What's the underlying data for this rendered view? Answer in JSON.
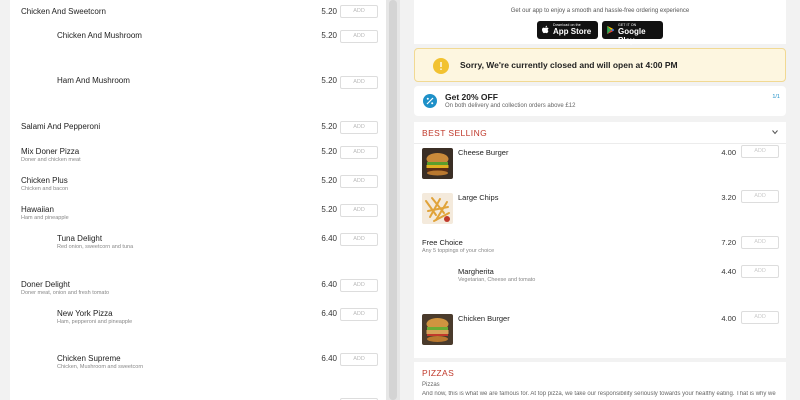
{
  "left_menu": {
    "add_label": "ADD",
    "items": [
      {
        "name": "Chicken And Sweetcorn",
        "desc": "",
        "price": "5.20"
      },
      {
        "name": "Chicken And Mushroom",
        "desc": "",
        "price": "5.20"
      },
      {
        "name": "Ham And Mushroom",
        "desc": "",
        "price": "5.20"
      },
      {
        "name": "Salami And Pepperoni",
        "desc": "",
        "price": "5.20"
      },
      {
        "name": "Mix Doner Pizza",
        "desc": "Doner and chicken meat",
        "price": "5.20"
      },
      {
        "name": "Chicken Plus",
        "desc": "Chicken and bacon",
        "price": "5.20"
      },
      {
        "name": "Hawaiian",
        "desc": "Ham and pineapple",
        "price": "5.20"
      },
      {
        "name": "Tuna Delight",
        "desc": "Red onion, sweetcorn and tuna",
        "price": "6.40"
      },
      {
        "name": "Doner Delight",
        "desc": "Doner meat, onion and fresh tomato",
        "price": "6.40"
      },
      {
        "name": "New York Pizza",
        "desc": "Ham, pepperoni and pineapple",
        "price": "6.40"
      },
      {
        "name": "Chicken Supreme",
        "desc": "Chicken, Mushroom and sweetcorn",
        "price": "6.40"
      }
    ]
  },
  "download": {
    "subtitle": "Get our app to enjoy a smooth and hassle-free ordering experience",
    "appstore_small": "Download on the",
    "appstore_large": "App Store",
    "googleplay_small": "GET IT ON",
    "googleplay_large": "Google Play"
  },
  "closed_notice": {
    "text": "Sorry, We're currently closed and will open at 4:00 PM"
  },
  "offer": {
    "title": "Get 20% OFF",
    "subtitle": "On both delivery and collection orders above £12",
    "pager": "1/1"
  },
  "best_selling": {
    "heading": "BEST SELLING",
    "add_label": "ADD",
    "items": [
      {
        "name": "Cheese Burger",
        "desc": "",
        "price": "4.00",
        "image": "burger"
      },
      {
        "name": "Large Chips",
        "desc": "",
        "price": "3.20",
        "image": "chips"
      },
      {
        "name": "Free Choice",
        "desc": "Any 5 toppings of your choice",
        "price": "7.20",
        "image": ""
      },
      {
        "name": "Margherita",
        "desc": "Vegetarian, Cheese and tomato",
        "price": "4.40",
        "image": ""
      },
      {
        "name": "Chicken Burger",
        "desc": "",
        "price": "4.00",
        "image": "burger"
      }
    ]
  },
  "pizzas": {
    "heading": "PIZZAS",
    "subtitle": "Pizzas",
    "body": "And now, this is what we are famous for. At top pizza, we take our responsibility seriously towards your healthy eating. That is why we"
  },
  "colors": {
    "accent_red": "#c0392b",
    "notice_yellow": "#f2c230",
    "offer_blue": "#1e90c8"
  }
}
